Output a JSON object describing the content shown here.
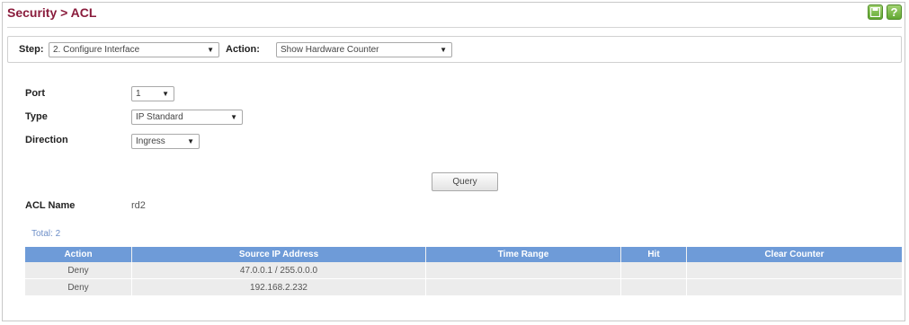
{
  "header": {
    "title": "Security > ACL",
    "help_icons": [
      "save-icon",
      "help-icon"
    ]
  },
  "stepbar": {
    "step_label": "Step:",
    "step_value": "2. Configure Interface",
    "action_label": "Action:",
    "action_value": "Show Hardware Counter"
  },
  "form": {
    "port_label": "Port",
    "port_value": "1",
    "type_label": "Type",
    "type_value": "IP Standard",
    "direction_label": "Direction",
    "direction_value": "Ingress",
    "query_button": "Query"
  },
  "acl": {
    "name_label": "ACL Name",
    "name_value": "rd2"
  },
  "table": {
    "total": "Total: 2",
    "columns": [
      "Action",
      "Source IP Address",
      "Time Range",
      "Hit",
      "Clear Counter"
    ],
    "rows": [
      [
        "Deny",
        "47.0.0.1 / 255.0.0.0",
        "",
        "",
        ""
      ],
      [
        "Deny",
        "192.168.2.232",
        "",
        "",
        ""
      ]
    ]
  },
  "colors": {
    "title": "#8a1c3c",
    "table_header": "#6e9bd8",
    "row_bg": "#ececec",
    "icon_green": "#62a833"
  }
}
